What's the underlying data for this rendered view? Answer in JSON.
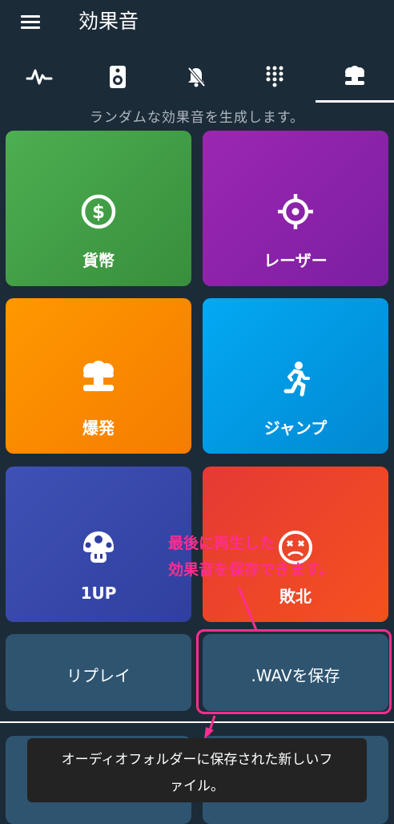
{
  "appbar": {
    "title": "効果音",
    "menu_icon": "hamburger-menu-icon"
  },
  "tabs": [
    {
      "icon": "waveform-icon",
      "selected": false
    },
    {
      "icon": "speaker-icon",
      "selected": false
    },
    {
      "icon": "bell-off-icon",
      "selected": false
    },
    {
      "icon": "dialpad-icon",
      "selected": false
    },
    {
      "icon": "explosion-icon",
      "selected": true
    }
  ],
  "subtitle": "ランダムな効果音を生成します。",
  "tiles": [
    {
      "label": "貨幣",
      "icon": "coin-icon",
      "color": "#43a047"
    },
    {
      "label": "レーザー",
      "icon": "crosshair-icon",
      "color": "#8e24aa"
    },
    {
      "label": "爆発",
      "icon": "explosion-icon",
      "color": "#fb8c00"
    },
    {
      "label": "ジャンプ",
      "icon": "running-person-icon",
      "color": "#039be5"
    },
    {
      "label": "1UP",
      "icon": "mushroom-icon",
      "color": "#3949ab"
    },
    {
      "label": "敗北",
      "icon": "dead-face-icon",
      "color": "#e53935"
    }
  ],
  "buttons": {
    "replay": "リプレイ",
    "save_wav": ".WAVを保存"
  },
  "callout": {
    "line1": "最後に再生した",
    "line2": "効果音を保存できます。",
    "color": "#ff2d8f"
  },
  "toast": {
    "line1": "オーディオフォルダーに保存された新しいフ",
    "line2": "ァイル。"
  }
}
